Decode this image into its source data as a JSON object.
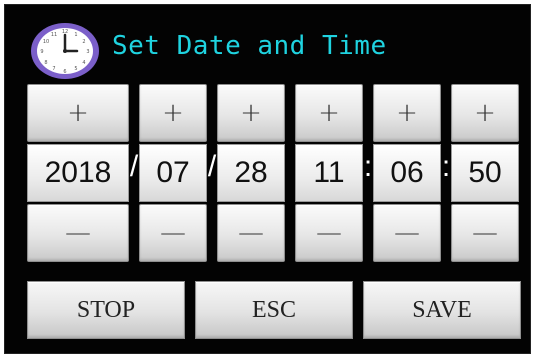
{
  "header": {
    "title": "Set Date and Time",
    "icon": "clock-icon"
  },
  "fields": [
    {
      "name": "year",
      "value": "2018"
    },
    {
      "name": "month",
      "value": "07"
    },
    {
      "name": "day",
      "value": "28"
    },
    {
      "name": "hour",
      "value": "11"
    },
    {
      "name": "minute",
      "value": "06"
    },
    {
      "name": "second",
      "value": "50"
    }
  ],
  "steppers": {
    "plus": "+",
    "minus": "—"
  },
  "separators": [
    "/",
    "/",
    ":",
    ":"
  ],
  "actions": {
    "stop": "STOP",
    "esc": "ESC",
    "save": "SAVE"
  },
  "colors": {
    "background": "#030303",
    "title": "#1fd3e0",
    "clock_ring": "#7b5fc9"
  }
}
